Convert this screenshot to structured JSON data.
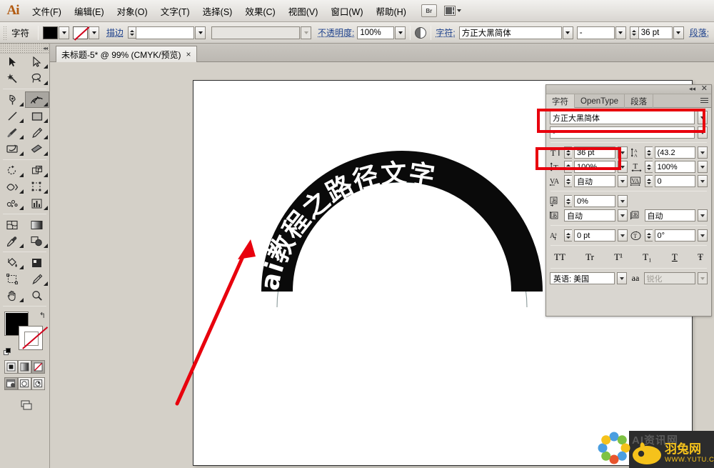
{
  "app": {
    "name": "Ai",
    "logo_text": "Ai"
  },
  "menubar": {
    "items": [
      {
        "label": "文件(F)",
        "name": "menu-file"
      },
      {
        "label": "编辑(E)",
        "name": "menu-edit"
      },
      {
        "label": "对象(O)",
        "name": "menu-object"
      },
      {
        "label": "文字(T)",
        "name": "menu-type"
      },
      {
        "label": "选择(S)",
        "name": "menu-select"
      },
      {
        "label": "效果(C)",
        "name": "menu-effect"
      },
      {
        "label": "视图(V)",
        "name": "menu-view"
      },
      {
        "label": "窗口(W)",
        "name": "menu-window"
      },
      {
        "label": "帮助(H)",
        "name": "menu-help"
      }
    ],
    "bridge_label": "Br",
    "arrange_label": ""
  },
  "controlbar": {
    "panel_label": "字符",
    "fill_color": "#000000",
    "stroke_color": "none",
    "stroke_label": "描边",
    "stroke_weight": "",
    "stroke_profile": "",
    "opacity_label": "不透明度:",
    "opacity_value": "100%",
    "character_label": "字符:",
    "font_family": "方正大黑简体",
    "font_style": "-",
    "font_size": "36 pt",
    "paragraph_label": "段落:"
  },
  "document": {
    "tab_title": "未标题-5* @ 99% (CMYK/预览)",
    "close_glyph": "×",
    "zoom": "99%",
    "color_mode": "CMYK",
    "view_mode": "预览"
  },
  "toolbar": {
    "tools": [
      {
        "name": "selection-tool",
        "label": "选择工具",
        "selected": false
      },
      {
        "name": "direct-selection-tool",
        "label": "直接选择工具",
        "selected": false
      },
      {
        "name": "magic-wand-tool",
        "label": "魔棒工具",
        "selected": false
      },
      {
        "name": "lasso-tool",
        "label": "套索工具",
        "selected": false
      },
      {
        "name": "pen-tool",
        "label": "钢笔工具",
        "selected": false
      },
      {
        "name": "type-on-path-tool",
        "label": "路径文字工具",
        "selected": true
      },
      {
        "name": "line-segment-tool",
        "label": "直线段工具",
        "selected": false
      },
      {
        "name": "rectangle-tool",
        "label": "矩形工具",
        "selected": false
      },
      {
        "name": "paintbrush-tool",
        "label": "画笔工具",
        "selected": false
      },
      {
        "name": "pencil-tool",
        "label": "铅笔工具",
        "selected": false
      },
      {
        "name": "blob-brush-tool",
        "label": "斑点画笔工具",
        "selected": false
      },
      {
        "name": "eraser-tool",
        "label": "橡皮擦工具",
        "selected": false
      },
      {
        "name": "rotate-tool",
        "label": "旋转工具",
        "selected": false
      },
      {
        "name": "scale-tool",
        "label": "比例缩放工具",
        "selected": false
      },
      {
        "name": "width-tool",
        "label": "宽度工具",
        "selected": false
      },
      {
        "name": "free-transform-tool",
        "label": "自由变换工具",
        "selected": false
      },
      {
        "name": "symbol-sprayer-tool",
        "label": "符号喷枪工具",
        "selected": false
      },
      {
        "name": "column-graph-tool",
        "label": "柱形图工具",
        "selected": false
      },
      {
        "name": "mesh-tool",
        "label": "网格工具",
        "selected": false
      },
      {
        "name": "gradient-tool",
        "label": "渐变工具",
        "selected": false
      },
      {
        "name": "eyedropper-tool",
        "label": "吸管工具",
        "selected": false
      },
      {
        "name": "blend-tool",
        "label": "混合工具",
        "selected": false
      },
      {
        "name": "live-paint-bucket-tool",
        "label": "实时上色工具",
        "selected": false
      },
      {
        "name": "live-paint-selection-tool",
        "label": "实时上色选择工具",
        "selected": false
      },
      {
        "name": "artboard-tool",
        "label": "画板工具",
        "selected": false
      },
      {
        "name": "slice-tool",
        "label": "切片工具",
        "selected": false
      },
      {
        "name": "hand-tool",
        "label": "抓手工具",
        "selected": false
      },
      {
        "name": "zoom-tool",
        "label": "缩放工具",
        "selected": false
      }
    ],
    "fill_color": "#000000",
    "stroke_color": "#ffffff",
    "stroke_is_none": true,
    "swap_glyph": "↰",
    "paint_modes": [
      {
        "name": "color-mode-button",
        "selected": false
      },
      {
        "name": "gradient-mode-button",
        "selected": false
      },
      {
        "name": "none-mode-button",
        "selected": true
      }
    ],
    "screen_modes": [
      {
        "name": "normal-screen-mode-button",
        "selected": true
      },
      {
        "name": "fullscreen-menubar-mode-button",
        "selected": false
      },
      {
        "name": "fullscreen-mode-button",
        "selected": false
      }
    ]
  },
  "canvas": {
    "path_text": "ai教程之路径文字",
    "path_text_fill": "#ffffff",
    "path_text_background": "#000000",
    "arc_stroke": "#8a9a9a",
    "artboard_background": "#ffffff",
    "annotation_arrow_color": "#e8000d"
  },
  "character_panel": {
    "tabs": [
      {
        "label": "字符",
        "name": "tab-character",
        "active": true
      },
      {
        "label": "OpenType",
        "name": "tab-opentype",
        "active": false
      },
      {
        "label": "段落",
        "name": "tab-paragraph",
        "active": false
      }
    ],
    "font_family": "方正大黑简体",
    "font_style": "-",
    "font_size": "36 pt",
    "leading": "(43.2",
    "vertical_scale": "100%",
    "horizontal_scale": "100%",
    "kerning": "自动",
    "tracking": "0",
    "aki_percent": "0%",
    "aki_before": "自动",
    "aki_after": "自动",
    "baseline_shift": "0 pt",
    "character_rotation": "0°",
    "styles": [
      {
        "glyph": "TT",
        "name": "all-caps-button"
      },
      {
        "glyph": "Tr",
        "name": "small-caps-button"
      },
      {
        "glyph": "T¹",
        "name": "superscript-button"
      },
      {
        "glyph": "T₁",
        "name": "subscript-button"
      },
      {
        "glyph": "T",
        "name": "underline-button"
      },
      {
        "glyph": "Ŧ",
        "name": "strikethrough-button"
      }
    ],
    "language": "英语: 美国",
    "anti_alias_label": "aa",
    "anti_alias_value": "锐化"
  },
  "watermark": {
    "top_text": "AI资讯网",
    "brand_text": "羽兔网",
    "url_text": "WWW.YUTU.CN",
    "accent_color": "#f5c21b"
  }
}
